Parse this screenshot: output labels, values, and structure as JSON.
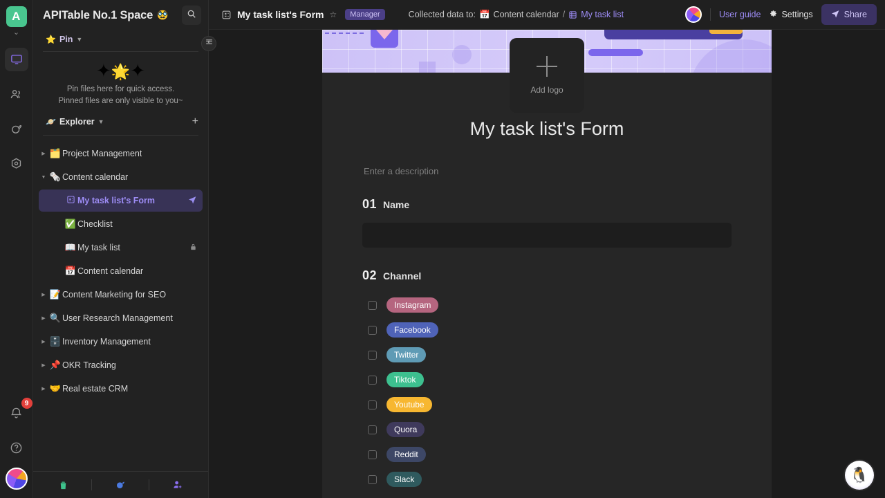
{
  "rail": {
    "workspace_initial": "A",
    "items": [
      {
        "name": "workspace",
        "icon": "monitor-icon",
        "active": true
      },
      {
        "name": "members",
        "icon": "people-icon",
        "active": false
      },
      {
        "name": "templates",
        "icon": "planet-icon",
        "active": false
      },
      {
        "name": "settings",
        "icon": "hexagon-gear-icon",
        "active": false
      }
    ],
    "notification_badge": "9"
  },
  "sidebar": {
    "space_name": "APITable No.1 Space",
    "space_emoji": "🥸",
    "search_icon": "search-icon",
    "pin": {
      "label": "Pin",
      "star_icon": "star-icon",
      "empty_line1": "Pin files here for quick access.",
      "empty_line2": "Pinned files are only visible to you~"
    },
    "explorer": {
      "label": "Explorer",
      "add_label": "+"
    },
    "tree": [
      {
        "label": "Project Management",
        "emoji": "🗂️",
        "arrow": "▸",
        "level": 0,
        "selected": false,
        "tail": ""
      },
      {
        "label": "Content calendar",
        "emoji": "🗞️",
        "arrow": "▾",
        "level": 0,
        "selected": false,
        "tail": ""
      },
      {
        "label": "My task list's Form",
        "emoji": "",
        "arrow": "",
        "level": 1,
        "selected": true,
        "tail": "send-icon"
      },
      {
        "label": "Checklist",
        "emoji": "✅",
        "arrow": "",
        "level": 1,
        "selected": false,
        "tail": ""
      },
      {
        "label": "My task list",
        "emoji": "📖",
        "arrow": "",
        "level": 1,
        "selected": false,
        "tail": "lock-icon"
      },
      {
        "label": "Content calendar",
        "emoji": "📅",
        "arrow": "",
        "level": 1,
        "selected": false,
        "tail": ""
      },
      {
        "label": "Content Marketing for SEO",
        "emoji": "📝",
        "arrow": "▸",
        "level": 0,
        "selected": false,
        "tail": ""
      },
      {
        "label": "User Research Management",
        "emoji": "🔍",
        "arrow": "▸",
        "level": 0,
        "selected": false,
        "tail": ""
      },
      {
        "label": "Inventory Management",
        "emoji": "🗄️",
        "arrow": "▸",
        "level": 0,
        "selected": false,
        "tail": ""
      },
      {
        "label": "OKR Tracking",
        "emoji": "📌",
        "arrow": "▸",
        "level": 0,
        "selected": false,
        "tail": ""
      },
      {
        "label": "Real estate CRM",
        "emoji": "🤝",
        "arrow": "▸",
        "level": 0,
        "selected": false,
        "tail": ""
      }
    ],
    "footer": [
      {
        "name": "trash",
        "icon": "trash-icon",
        "glyph": "🗑️"
      },
      {
        "name": "templates",
        "icon": "planet-icon",
        "glyph": "🪐"
      },
      {
        "name": "invite-member",
        "icon": "add-person-icon",
        "glyph": "👤"
      }
    ],
    "collapse_icon": "collapse-sidebar-icon"
  },
  "topbar": {
    "doc_icon": "form-icon",
    "title": "My task list's Form",
    "favorite_icon": "star-outline-icon",
    "role": "Manager",
    "collected_label": "Collected data to:",
    "collected_datasheet": "Content calendar",
    "collected_separator": "/",
    "collected_view": "My task list",
    "user_guide": "User guide",
    "settings": "Settings",
    "settings_icon": "gear-icon",
    "share": "Share",
    "share_icon": "send-icon"
  },
  "form": {
    "add_logo_label": "Add logo",
    "title": "My task list's Form",
    "description_placeholder": "Enter a description",
    "questions": [
      {
        "number": "01",
        "label": "Name",
        "type": "text",
        "value": ""
      },
      {
        "number": "02",
        "label": "Channel",
        "type": "checkbox",
        "options": [
          {
            "label": "Instagram",
            "color": "#b5657f"
          },
          {
            "label": "Facebook",
            "color": "#4f63b8"
          },
          {
            "label": "Twitter",
            "color": "#5f9bb5"
          },
          {
            "label": "Tiktok",
            "color": "#3dc08f"
          },
          {
            "label": "Youtube",
            "color": "#f7b731"
          },
          {
            "label": "Quora",
            "color": "#3f3a5c"
          },
          {
            "label": "Reddit",
            "color": "#3d4766"
          },
          {
            "label": "Slack",
            "color": "#2f5a5e"
          }
        ]
      }
    ],
    "mascot_icon": "assistant-mascot-icon"
  }
}
